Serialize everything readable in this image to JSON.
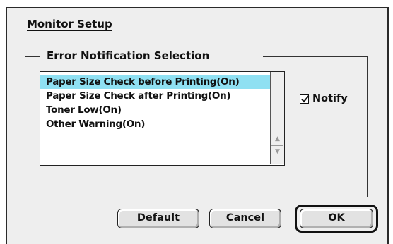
{
  "dialog": {
    "title": "Monitor Setup",
    "group_label": "Error Notification Selection",
    "list": {
      "items": [
        {
          "label": "Paper Size Check before Printing(On)",
          "selected": true
        },
        {
          "label": "Paper Size Check after Printing(On)",
          "selected": false
        },
        {
          "label": "Toner Low(On)",
          "selected": false
        },
        {
          "label": "Other Warning(On)",
          "selected": false
        }
      ],
      "selection_color": "#8fe0f2"
    },
    "notify": {
      "label": "Notify",
      "checked": true
    },
    "buttons": {
      "default_label": "Default",
      "cancel_label": "Cancel",
      "ok_label": "OK"
    }
  }
}
